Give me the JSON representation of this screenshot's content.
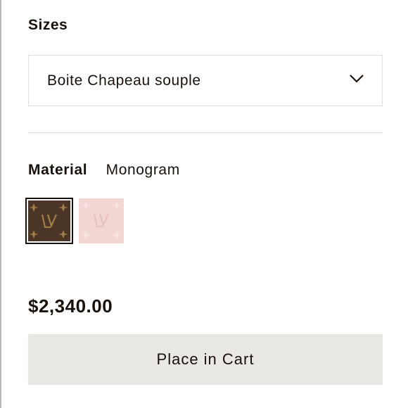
{
  "sizes": {
    "heading": "Sizes",
    "selected": "Boite Chapeau souple",
    "chevron_icon": "chevron-down-icon"
  },
  "material": {
    "label": "Material",
    "value": "Monogram",
    "swatches": [
      {
        "name": "Monogram",
        "selected": true,
        "color": "#4a3527"
      },
      {
        "name": "Monogram Empreinte rose",
        "selected": false,
        "color": "#f1d6d3"
      }
    ]
  },
  "price": "$2,340.00",
  "cart_button": {
    "label": "Place in Cart",
    "color": "#eae8e4"
  }
}
